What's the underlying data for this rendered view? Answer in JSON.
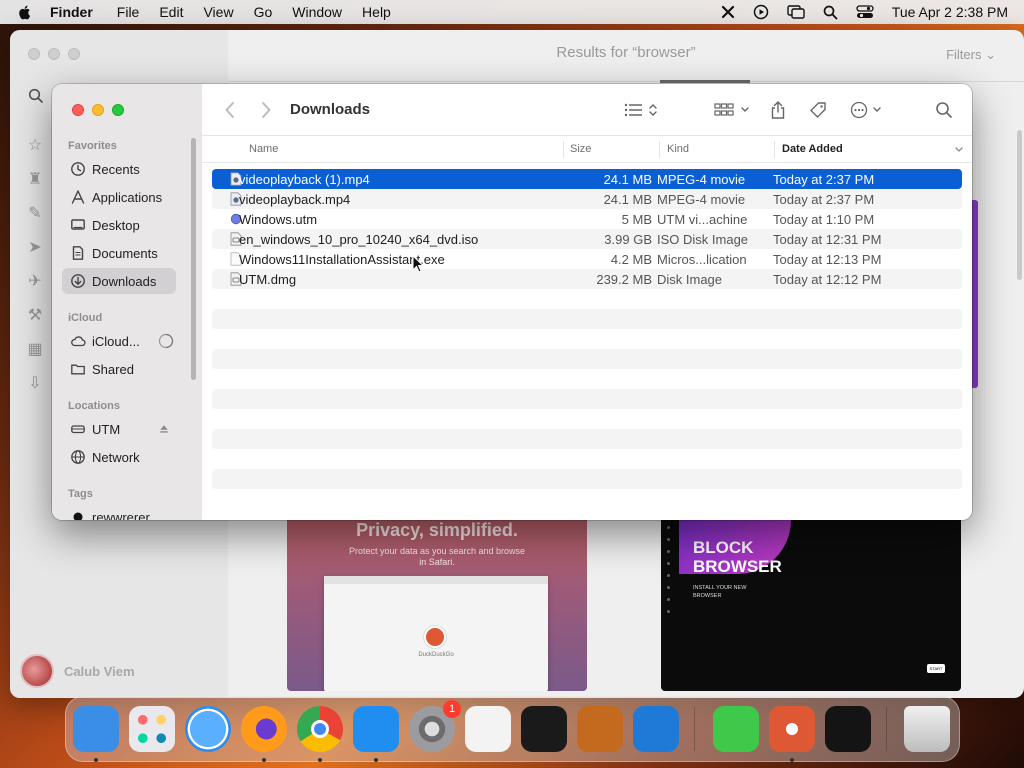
{
  "menubar": {
    "app_name": "Finder",
    "menus": [
      "File",
      "Edit",
      "View",
      "Go",
      "Window",
      "Help"
    ],
    "datetime": "Tue Apr 2  2:38 PM"
  },
  "background_window": {
    "title": "Results for “browser”",
    "filters_label": "Filters",
    "user_name": "Calub Viem",
    "cards": {
      "safari": {
        "title": "Privacy, simplified.",
        "subtitle": "Protect your data as you search and browse in Safari.",
        "search_engine": "DuckDuckGo"
      },
      "block": {
        "title_line1": "BLOCK",
        "title_line2": "BROWSER",
        "subtitle": "INSTALL YOUR NEW BROWSER",
        "button": "START"
      }
    }
  },
  "finder": {
    "title": "Downloads",
    "sidebar": {
      "favorites_label": "Favorites",
      "favorites": [
        "Recents",
        "Applications",
        "Desktop",
        "Documents",
        "Downloads"
      ],
      "active": "Downloads",
      "icloud_label": "iCloud",
      "icloud": [
        "iCloud...",
        "Shared"
      ],
      "locations_label": "Locations",
      "locations": [
        "UTM",
        "Network"
      ],
      "tags_label": "Tags",
      "tags": [
        "rewwrerer"
      ]
    },
    "columns": {
      "name": "Name",
      "size": "Size",
      "kind": "Kind",
      "date_added": "Date Added"
    },
    "files": [
      {
        "name": "videoplayback (1).mp4",
        "size": "24.1 MB",
        "kind": "MPEG-4 movie",
        "date": "Today at 2:37 PM",
        "icon": "video-file-icon",
        "selected": true
      },
      {
        "name": "videoplayback.mp4",
        "size": "24.1 MB",
        "kind": "MPEG-4 movie",
        "date": "Today at 2:37 PM",
        "icon": "video-file-icon",
        "selected": false
      },
      {
        "name": "Windows.utm",
        "size": "5 MB",
        "kind": "UTM vi...achine",
        "date": "Today at 1:10 PM",
        "icon": "utm-file-icon",
        "selected": false
      },
      {
        "name": "en_windows_10_pro_10240_x64_dvd.iso",
        "size": "3.99 GB",
        "kind": "ISO Disk Image",
        "date": "Today at 12:31 PM",
        "icon": "disk-image-icon",
        "selected": false
      },
      {
        "name": "Windows11InstallationAssistant.exe",
        "size": "4.2 MB",
        "kind": "Micros...lication",
        "date": "Today at 12:13 PM",
        "icon": "exe-file-icon",
        "selected": false
      },
      {
        "name": "UTM.dmg",
        "size": "239.2 MB",
        "kind": "Disk Image",
        "date": "Today at 12:12 PM",
        "icon": "disk-image-icon",
        "selected": false
      }
    ]
  },
  "dock": {
    "apps": [
      {
        "name": "finder-app",
        "color": "#3a8ee6",
        "running": true
      },
      {
        "name": "launchpad-app",
        "color": "#e8e8ee",
        "running": false
      },
      {
        "name": "safari-app",
        "color": "#2d8cf0",
        "running": false
      },
      {
        "name": "firefox-app",
        "color": "#ff7a1a",
        "running": true
      },
      {
        "name": "chrome-app",
        "color": "#ffffff",
        "running": true
      },
      {
        "name": "app-store-app",
        "color": "#1f8ef0",
        "running": true
      },
      {
        "name": "system-settings-app",
        "color": "#8c8c90",
        "running": false,
        "badge": "1"
      },
      {
        "name": "textedit-app",
        "color": "#f3f3f3",
        "running": false
      },
      {
        "name": "terminal-app",
        "color": "#1a1a1a",
        "running": false
      },
      {
        "name": "garageband-app",
        "color": "#c46a1e",
        "running": false
      },
      {
        "name": "vscode-app",
        "color": "#1e7ad6",
        "running": false
      },
      {
        "name": "messages-app",
        "color": "#3ec94a",
        "running": false
      },
      {
        "name": "duckduckgo-app",
        "color": "#de5833",
        "running": true
      },
      {
        "name": "vectorworks-app",
        "color": "#141414",
        "running": false
      },
      {
        "name": "trash-app",
        "color": "#d9d9d9",
        "running": false
      }
    ]
  }
}
